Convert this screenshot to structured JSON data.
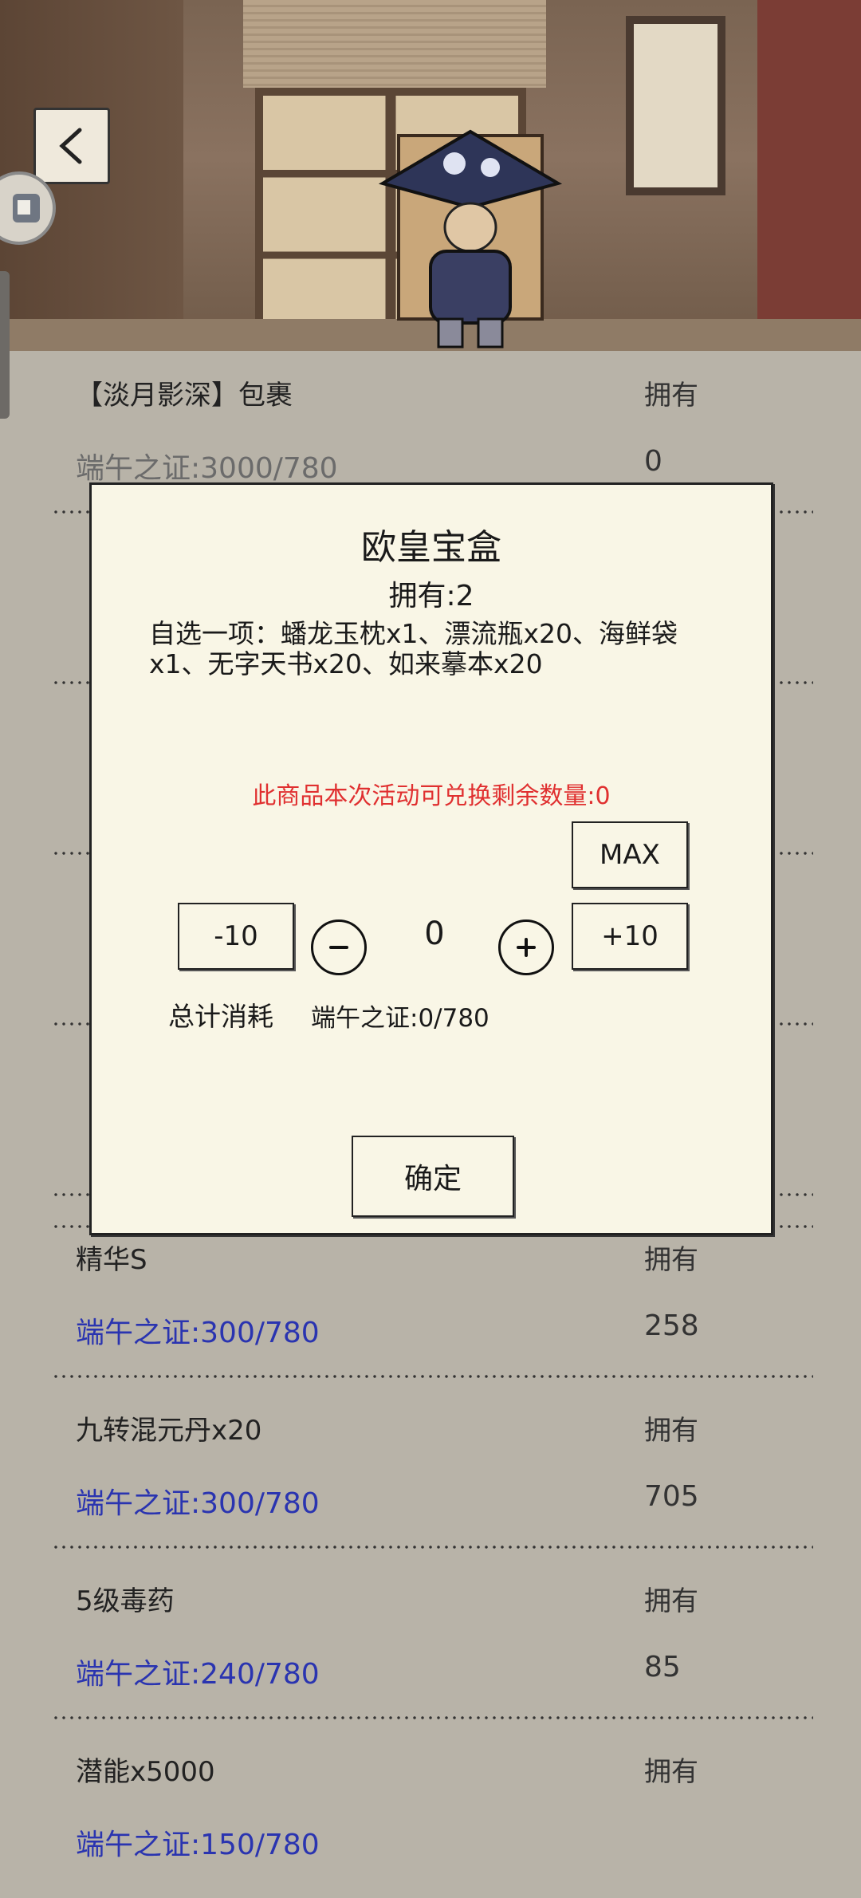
{
  "nav": {
    "back_icon": "chevron-left-icon",
    "side_icon": "app-badge-icon"
  },
  "list": {
    "header": {
      "name": "【淡月影深】包裹",
      "own_label": "拥有"
    },
    "items": [
      {
        "name": "",
        "cost": "端午之证:3000/780",
        "own_value": "0"
      },
      {
        "name": "精华S",
        "cost": "端午之证:300/780",
        "own_label": "拥有",
        "own_value": "258"
      },
      {
        "name": "九转混元丹x20",
        "cost": "端午之证:300/780",
        "own_label": "拥有",
        "own_value": "705"
      },
      {
        "name": "5级毒药",
        "cost": "端午之证:240/780",
        "own_label": "拥有",
        "own_value": "85"
      },
      {
        "name": "潜能x5000",
        "cost": "端午之证:150/780",
        "own_label": "拥有",
        "own_value": ""
      }
    ]
  },
  "dialog": {
    "title": "欧皇宝盒",
    "owned": "拥有:2",
    "description": "自选一项：蟠龙玉枕x1、漂流瓶x20、海鲜袋x1、无字天书x20、如来摹本x20",
    "remaining": "此商品本次活动可兑换剩余数量:0",
    "max_label": "MAX",
    "minus10_label": "-10",
    "plus10_label": "+10",
    "quantity": "0",
    "total_label": "总计消耗",
    "total_value": "端午之证:0/780",
    "confirm_label": "确定",
    "icons": {
      "minus": "minus-circle-icon",
      "plus": "plus-circle-icon"
    },
    "colors": {
      "remaining": "#e03030",
      "cost": "#2a34b0"
    }
  }
}
